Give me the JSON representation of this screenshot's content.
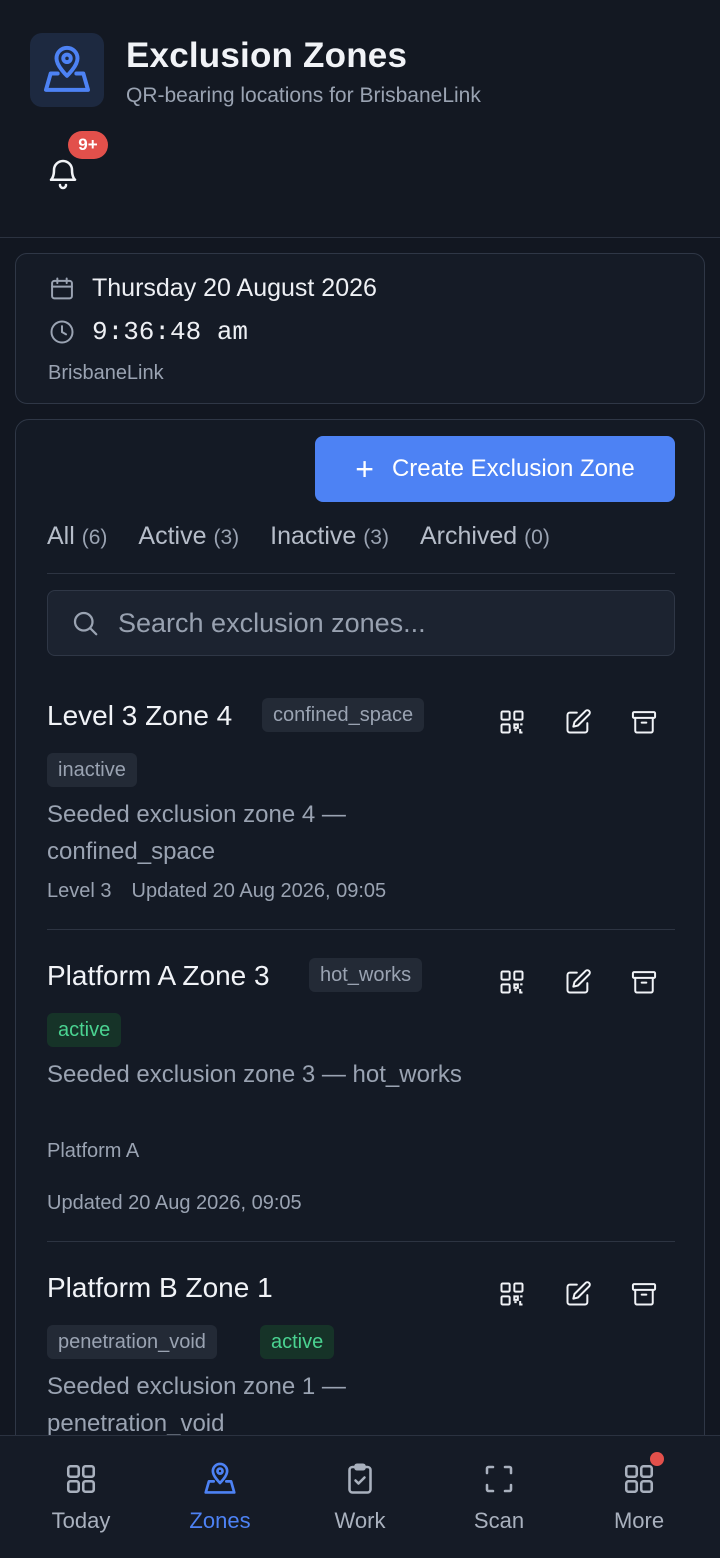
{
  "header": {
    "title": "Exclusion Zones",
    "subtitle": "QR-bearing locations for BrisbaneLink",
    "logo_icon": "map-pin-icon",
    "notification_badge": "9+"
  },
  "date_card": {
    "date": "Thursday 20 August 2026",
    "time": "9:36:48 am",
    "org": "BrisbaneLink"
  },
  "toolbar": {
    "create_label": "Create Exclusion Zone"
  },
  "tabs": [
    {
      "label": "All",
      "count": "(6)"
    },
    {
      "label": "Active",
      "count": "(3)"
    },
    {
      "label": "Inactive",
      "count": "(3)"
    },
    {
      "label": "Archived",
      "count": "(0)"
    }
  ],
  "search": {
    "placeholder": "Search exclusion zones..."
  },
  "zones": [
    {
      "name": "Level 3 Zone 4",
      "type": "confined_space",
      "status": "inactive",
      "description": "Seeded exclusion zone 4 — confined_space",
      "location": "Level 3",
      "updated": "Updated 20 Aug 2026, 09:05"
    },
    {
      "name": "Platform A Zone 3",
      "type": "hot_works",
      "status": "active",
      "description": "Seeded exclusion zone 3 — hot_works",
      "location": "Platform A",
      "updated": "Updated 20 Aug 2026, 09:05"
    },
    {
      "name": "Platform B Zone 1",
      "type": "penetration_void",
      "status": "active",
      "description": "Seeded exclusion zone 1 — penetration_void"
    }
  ],
  "bottom_nav": [
    {
      "label": "Today",
      "icon": "grid-icon"
    },
    {
      "label": "Zones",
      "icon": "map-pin-icon"
    },
    {
      "label": "Work",
      "icon": "clipboard-check-icon"
    },
    {
      "label": "Scan",
      "icon": "scan-icon"
    },
    {
      "label": "More",
      "icon": "apps-icon"
    }
  ],
  "colors": {
    "background": "#121721",
    "accent": "#4d82f4",
    "active_badge": "#4ad391",
    "notification": "#e2504b"
  }
}
